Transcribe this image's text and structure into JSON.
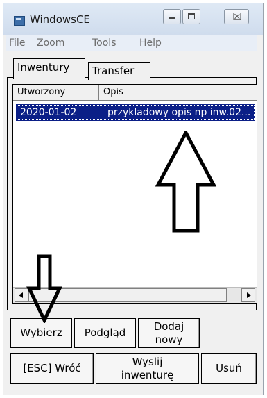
{
  "window": {
    "title": "WindowsCE",
    "caption_buttons": [
      "minimize-icon",
      "maximize-icon",
      "close-icon"
    ],
    "close_glyph": "☒"
  },
  "menu": {
    "items": [
      "File",
      "Zoom",
      "Tools",
      "Help"
    ]
  },
  "tabs": [
    {
      "label": "Inwentury",
      "selected": true
    },
    {
      "label": "Transfer",
      "selected": false
    }
  ],
  "listview": {
    "columns": [
      "Utworzony",
      "Opis"
    ],
    "rows": [
      {
        "created": "2020-01-02",
        "description": "przykladowy opis np inw.02...",
        "selected": true
      }
    ]
  },
  "buttons": {
    "select": "Wybierz",
    "preview": "Podgląd",
    "add_new_line1": "Dodaj",
    "add_new_line2": "nowy",
    "back": "[ESC] Wróć",
    "send_line1": "Wyslij",
    "send_line2": "inwenturę",
    "delete": "Usuń"
  },
  "colors": {
    "selection": "#0b1f87",
    "titlebar": "#d7e2f0",
    "menubar": "#e8eef7",
    "window_bg": "#f0f0f0"
  }
}
